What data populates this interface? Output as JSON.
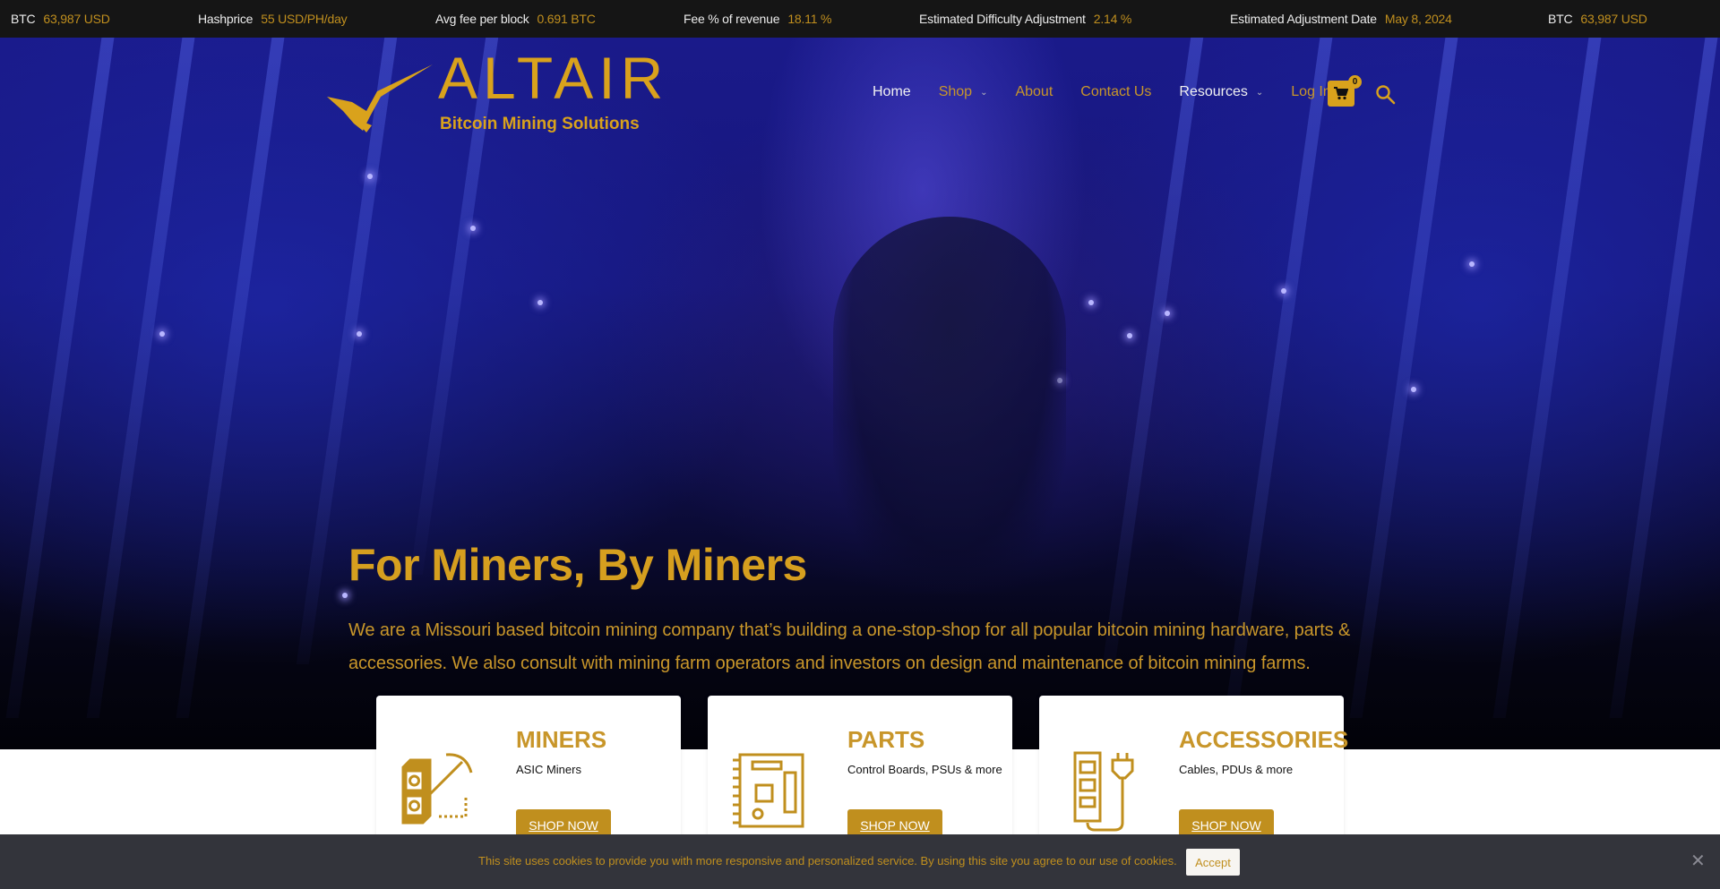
{
  "ticker": [
    {
      "label": "BTC",
      "value": "63,987 USD"
    },
    {
      "label": "Hashprice",
      "value": "55 USD/PH/day"
    },
    {
      "label": "Avg fee per block",
      "value": "0.691 BTC"
    },
    {
      "label": "Fee % of revenue",
      "value": "18.11 %"
    },
    {
      "label": "Estimated Difficulty Adjustment",
      "value": "2.14 %"
    },
    {
      "label": "Estimated Adjustment Date",
      "value": "May 8, 2024"
    },
    {
      "label": "BTC",
      "value": "63,987 USD"
    }
  ],
  "logo": {
    "brand": "ALTAIR",
    "tagline": "Bitcoin Mining Solutions",
    "icon": "eagle-wing-icon"
  },
  "nav": {
    "items": [
      {
        "label": "Home",
        "has_dropdown": false
      },
      {
        "label": "Shop",
        "has_dropdown": true
      },
      {
        "label": "About",
        "has_dropdown": false
      },
      {
        "label": "Contact Us",
        "has_dropdown": false
      },
      {
        "label": "Resources",
        "has_dropdown": true
      },
      {
        "label": "Log In",
        "has_dropdown": false
      }
    ],
    "dropdown_glyph": "⌄",
    "cart_count": "0",
    "cart_icon": "shopping-cart-icon",
    "search_icon": "search-icon"
  },
  "hero": {
    "title": "For Miners, By Miners",
    "description": "We are a Missouri based bitcoin mining company that’s building a one-stop-shop for all popular bitcoin mining hardware, parts & accessories. We also consult with mining farm operators and investors on design and maintenance of bitcoin mining farms."
  },
  "cards": [
    {
      "title": "MINERS",
      "description": "ASIC Miners",
      "button": "SHOP NOW",
      "icon": "asic-miner-pickaxe-icon"
    },
    {
      "title": "PARTS",
      "description": "Control Boards, PSUs & more",
      "button": "SHOP NOW",
      "icon": "circuit-board-icon"
    },
    {
      "title": "ACCESSORIES",
      "description": "Cables, PDUs & more",
      "button": "SHOP NOW",
      "icon": "power-strip-icon"
    }
  ],
  "cookie": {
    "message": "This site uses cookies to provide you with more responsive and personalized service. By using this site you agree to our use of cookies.",
    "accept": "Accept",
    "close": "✕"
  },
  "colors": {
    "gold": "#c08f1e",
    "ticker_bg": "#151515",
    "cookie_bg": "#33343b"
  }
}
